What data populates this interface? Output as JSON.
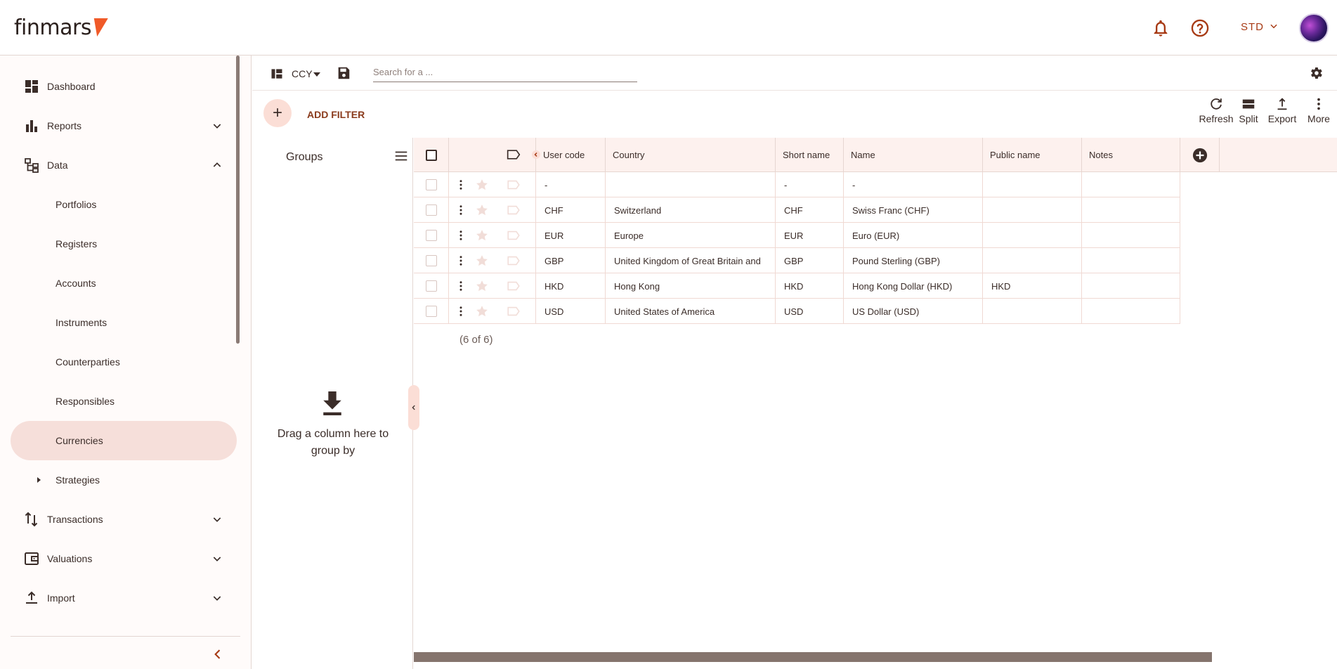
{
  "header": {
    "logo": "finmars",
    "std_select": "STD",
    "icons": [
      "bell-icon",
      "help-icon",
      "chevron-down-icon"
    ]
  },
  "sidebar": {
    "items": [
      {
        "label": "Dashboard",
        "icon": "dashboard-icon"
      },
      {
        "label": "Reports",
        "icon": "bar-chart-icon",
        "expanded": false
      },
      {
        "label": "Data",
        "icon": "data-tree-icon",
        "expanded": true
      },
      {
        "label": "Portfolios"
      },
      {
        "label": "Registers"
      },
      {
        "label": "Accounts"
      },
      {
        "label": "Instruments"
      },
      {
        "label": "Counterparties"
      },
      {
        "label": "Responsibles"
      },
      {
        "label": "Currencies",
        "active": true
      },
      {
        "label": "Strategies"
      },
      {
        "label": "Transactions",
        "icon": "swap-vert-icon",
        "expanded": false
      },
      {
        "label": "Valuations",
        "icon": "wallet-icon",
        "expanded": false
      },
      {
        "label": "Import",
        "icon": "upload-icon",
        "expanded": false
      }
    ]
  },
  "toolbar": {
    "layout_label": "CCY",
    "search_placeholder": "Search for a ...",
    "add_filter": "ADD FILTER",
    "actions": {
      "refresh": "Refresh",
      "split": "Split",
      "export": "Export",
      "more": "More"
    }
  },
  "groups": {
    "title": "Groups",
    "drop_hint": "Drag a column here to group by"
  },
  "table": {
    "columns": [
      "User code",
      "Country",
      "Short name",
      "Name",
      "Public name",
      "Notes"
    ],
    "rows": [
      [
        "-",
        "",
        "-",
        "-",
        "",
        ""
      ],
      [
        "CHF",
        "Switzerland",
        "CHF",
        "Swiss Franc (CHF)",
        "",
        ""
      ],
      [
        "EUR",
        "Europe",
        "EUR",
        "Euro (EUR)",
        "",
        ""
      ],
      [
        "GBP",
        "United Kingdom of Great Britain and",
        "GBP",
        "Pound Sterling (GBP)",
        "",
        ""
      ],
      [
        "HKD",
        "Hong Kong",
        "HKD",
        "Hong Kong Dollar (HKD)",
        "HKD",
        ""
      ],
      [
        "USD",
        "United States of America",
        "USD",
        "US Dollar (USD)",
        "",
        ""
      ]
    ],
    "count": "(6 of 6)"
  },
  "colors": {
    "accent": "#a73a14",
    "active_bg": "#f6dfda",
    "header_bg": "#fdf1ee",
    "logo_mark": "#f05a28"
  }
}
